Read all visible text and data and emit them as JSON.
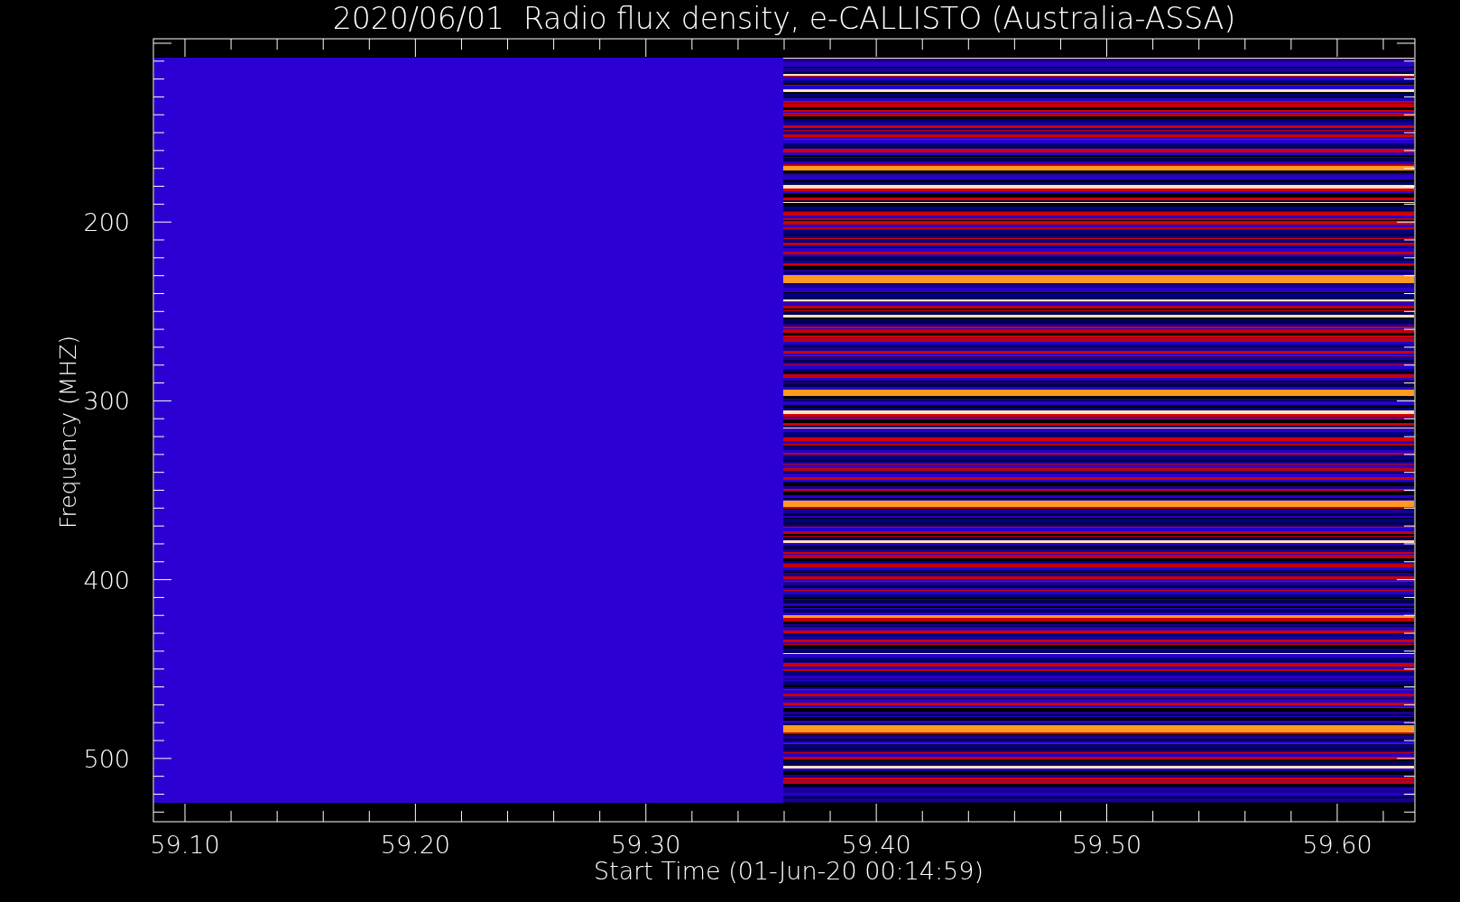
{
  "title": "2020/06/01  Radio flux density, e-CALLISTO (Australia-ASSA)",
  "y_axis": {
    "label": "Frequency (MHZ)",
    "ticks": [
      "200",
      "300",
      "400",
      "500"
    ]
  },
  "x_axis": {
    "label": "Start Time (01-Jun-20 00:14:59)",
    "ticks": [
      "59.10",
      "59.20",
      "59.30",
      "59.40",
      "59.50",
      "59.60"
    ]
  }
}
